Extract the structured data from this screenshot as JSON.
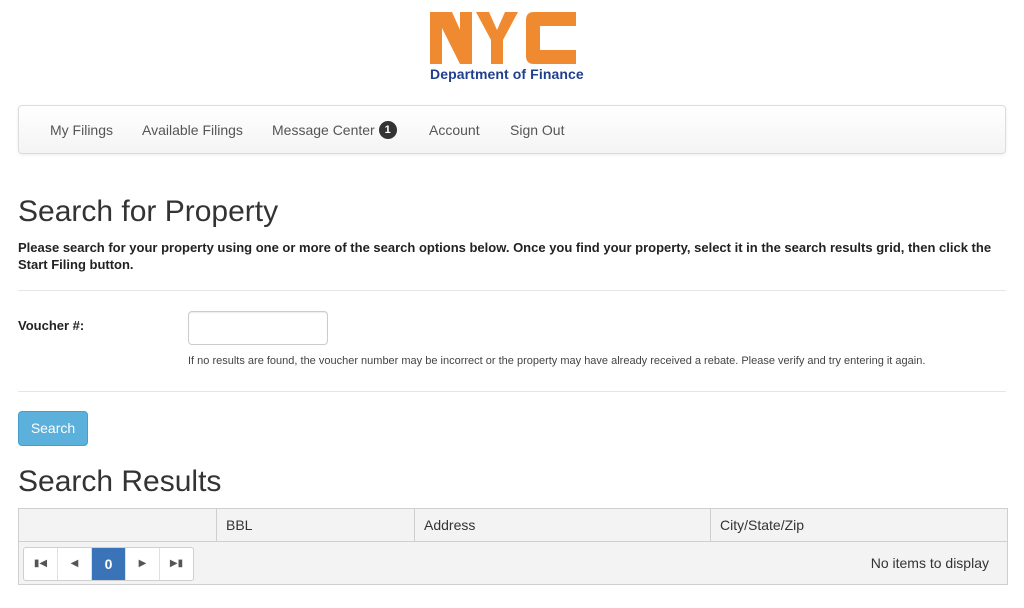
{
  "logo": {
    "text": "NYC",
    "department": "Department of Finance",
    "colors": {
      "orange": "#f08a30",
      "blue": "#1f3f8f"
    }
  },
  "nav": {
    "items": [
      {
        "label": "My Filings"
      },
      {
        "label": "Available Filings"
      },
      {
        "label": "Message Center",
        "badge": "1"
      },
      {
        "label": "Account"
      },
      {
        "label": "Sign Out"
      }
    ]
  },
  "page": {
    "title": "Search for Property",
    "intro": "Please search for your property using one or more of the search options below. Once you find your property, select it in the search results grid, then click the Start Filing button."
  },
  "search": {
    "voucher_label": "Voucher #:",
    "voucher_value": "",
    "help_text": "If no results are found, the voucher number may be incorrect or the property may have already received a rebate. Please verify and try entering it again.",
    "button_label": "Search",
    "button_color": "#5bb0dc"
  },
  "results": {
    "title": "Search Results",
    "columns": [
      "",
      "BBL",
      "Address",
      "City/State/Zip"
    ],
    "rows": [],
    "pager": {
      "first_icon": "first-page-icon",
      "prev_icon": "prev-page-icon",
      "current_page": "0",
      "next_icon": "next-page-icon",
      "last_icon": "last-page-icon"
    },
    "empty_text": "No items to display"
  }
}
